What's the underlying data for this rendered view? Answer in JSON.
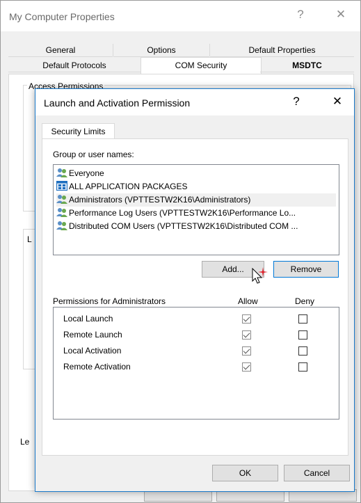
{
  "parent": {
    "title": "My Computer Properties",
    "help_btn": "?",
    "close_btn": "✕",
    "tabs_row1": [
      "General",
      "Options",
      "Default Properties"
    ],
    "tabs_row2": [
      "Default Protocols",
      "COM Security",
      "MSDTC"
    ],
    "group_access": "Access Permissions",
    "label_le": "Le"
  },
  "dialog": {
    "title": "Launch and Activation Permission",
    "help_btn": "?",
    "close_btn": "✕",
    "tab": "Security Limits",
    "group_label": "Group or user names:",
    "groups": [
      "Everyone",
      "ALL APPLICATION PACKAGES",
      "Administrators (VPTTESTW2K16\\Administrators)",
      "Performance Log Users (VPTTESTW2K16\\Performance Lo...",
      "Distributed COM Users (VPTTESTW2K16\\Distributed COM ..."
    ],
    "add_btn": "Add...",
    "remove_btn": "Remove",
    "perm_header": "Permissions for Administrators",
    "allow_header": "Allow",
    "deny_header": "Deny",
    "permissions": [
      {
        "name": "Local Launch",
        "allow": true,
        "deny": false
      },
      {
        "name": "Remote Launch",
        "allow": true,
        "deny": false
      },
      {
        "name": "Local Activation",
        "allow": true,
        "deny": false
      },
      {
        "name": "Remote Activation",
        "allow": true,
        "deny": false
      }
    ],
    "ok_btn": "OK",
    "cancel_btn": "Cancel"
  }
}
